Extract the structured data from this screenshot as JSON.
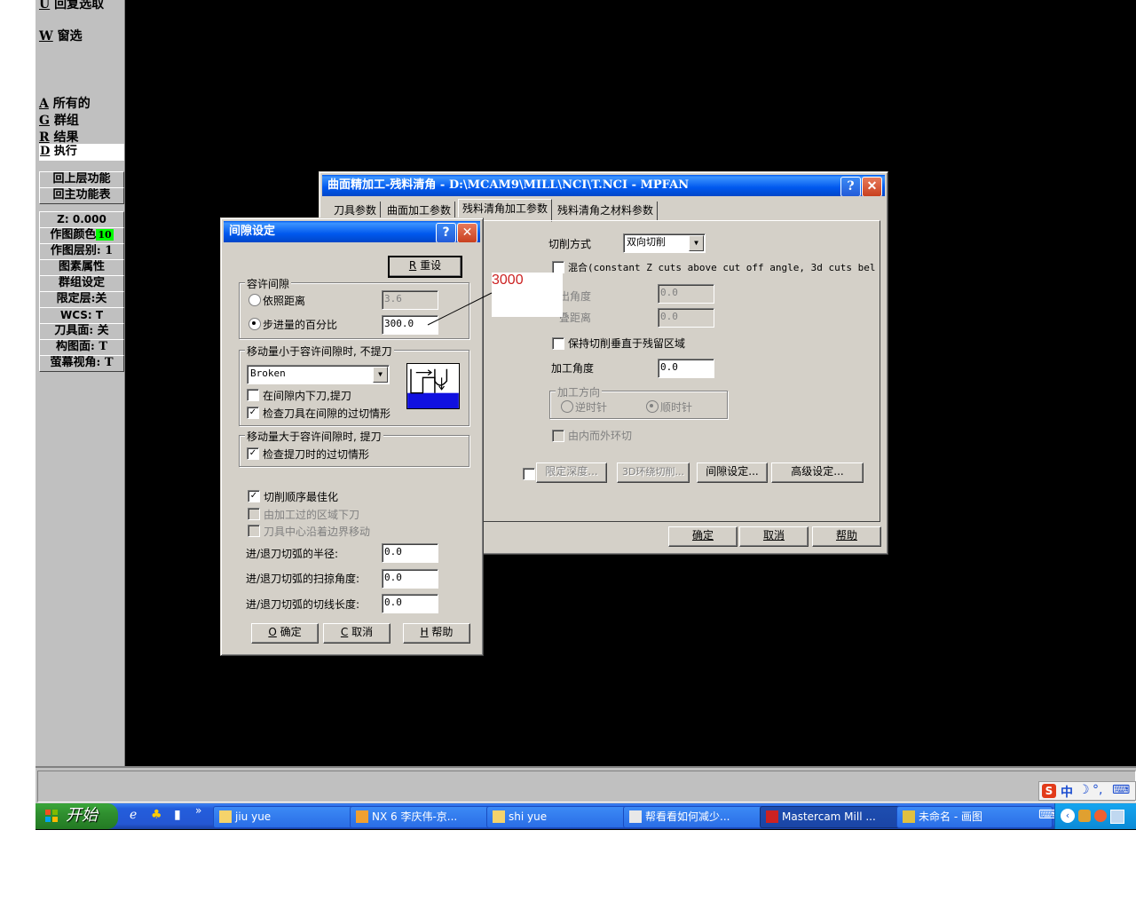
{
  "menu": {
    "items": [
      {
        "key": "U",
        "label": "回复选取"
      },
      {
        "key": "W",
        "label": "窗选"
      },
      {
        "key": "A",
        "label": "所有的"
      },
      {
        "key": "G",
        "label": "群组"
      },
      {
        "key": "R",
        "label": "结果"
      },
      {
        "key": "D",
        "label": "执行"
      }
    ],
    "buttons": [
      "回上层功能",
      "回主功能表"
    ],
    "status": {
      "z": "Z:  0.000",
      "color_label": "作图颜色",
      "color_value": "10",
      "level": "作图层别: 1",
      "attributes": "图素属性",
      "group_set": "群组设定",
      "limit_level": "限定层:关",
      "wcs": "WCS:  T",
      "tool_plane": "刀具面: 关",
      "construct_plane": "构图面: T",
      "screen_view": "萤幕视角: T"
    }
  },
  "main_dialog": {
    "title": "曲面精加工-残料清角 - D:\\MCAM9\\MILL\\NCI\\T.NCI - MPFAN",
    "tabs": [
      "刀具参数",
      "曲面加工参数",
      "残料清角加工参数",
      "残料清角之材料参数"
    ],
    "cut_method_label": "切削方式",
    "cut_method_value": "双向切削",
    "blend_label": "混合(constant Z cuts above cut off angle, 3d cuts bel",
    "angle_label_partial": "出角度",
    "angle_value": "0.0",
    "distance_label_partial": "叠距离",
    "distance_value": "0.0",
    "keep_perp_label": "保持切削垂直于残留区域",
    "machining_angle_label": "加工角度",
    "machining_angle_value": "0.0",
    "direction_group": "加工方向",
    "ccw_label": "逆时针",
    "cw_label": "顺时针",
    "inside_out_label": "由内而外环切",
    "limit_depth_btn": "限定深度...",
    "ring_cut_btn": "3D环绕切削...",
    "gap_btn": "间隙设定...",
    "advanced_btn": "高级设定...",
    "ok": "确定",
    "cancel": "取消",
    "help": "帮助"
  },
  "gap_dialog": {
    "title": "间隙设定",
    "reset_key": "R",
    "reset_label": "重设",
    "tol_group": "容许间隙",
    "by_distance_label": "依照距离",
    "by_distance_value": "3.6",
    "by_percent_label": "步进量的百分比",
    "by_percent_value": "300.0",
    "less_group": "移动量小于容许间隙时, 不提刀",
    "move_type": "Broken",
    "plunge_in_gap_label": "在间隙内下刀,提刀",
    "check_gouge_gap_label": "检查刀具在间隙的过切情形",
    "greater_group": "移动量大于容许间隙时, 提刀",
    "check_gouge_retract_label": "检查提刀时的过切情形",
    "optimize_label": "切削顺序最佳化",
    "plunge_machined_label": "由加工过的区域下刀",
    "tool_center_label": "刀具中心沿着边界移动",
    "arc_radius_label": "进/退刀切弧的半径:",
    "arc_radius_value": "0.0",
    "arc_sweep_label": "进/退刀切弧的扫掠角度:",
    "arc_sweep_value": "0.0",
    "arc_tangent_label": "进/退刀切弧的切线长度:",
    "arc_tangent_value": "0.0",
    "ok_key": "O",
    "ok": "确定",
    "cancel_key": "C",
    "cancel": "取消",
    "help_key": "H",
    "help": "帮助"
  },
  "annotation": {
    "text": "3000",
    "color": "#cc2222"
  },
  "taskbar": {
    "start": "开始",
    "tasks": [
      {
        "label": "jiu yue",
        "icon": "folder-icon"
      },
      {
        "label": "NX 6  李庆伟-京...",
        "icon": "nx-icon"
      },
      {
        "label": "shi yue",
        "icon": "folder-icon"
      },
      {
        "label": "帮看看如何减少...",
        "icon": "document-icon"
      },
      {
        "label": "Mastercam Mill ...",
        "icon": "mastercam-icon"
      },
      {
        "label": "未命名 - 画图",
        "icon": "paint-icon"
      }
    ],
    "ime": "中"
  }
}
